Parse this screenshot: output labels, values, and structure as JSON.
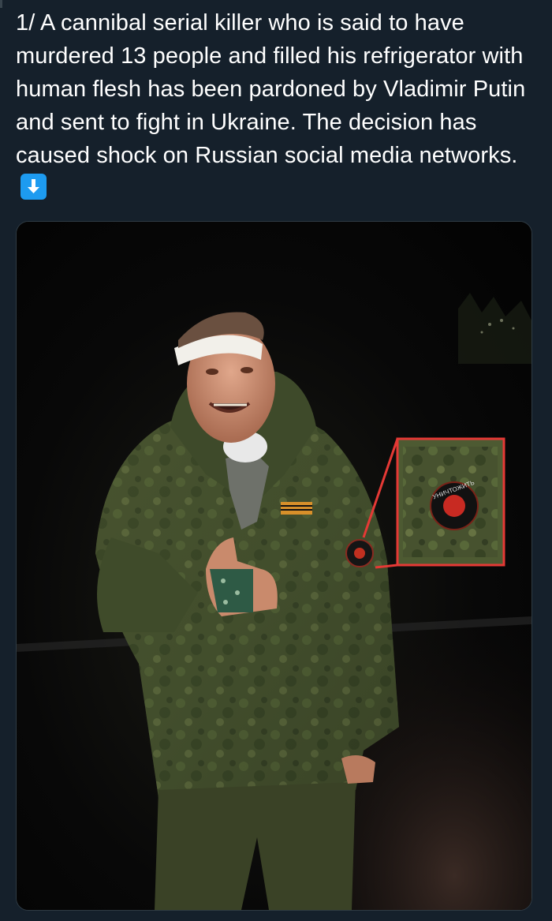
{
  "tweet": {
    "text": "1/ A cannibal serial killer who is said to have murdered 13 people and filled his refrigerator with human flesh has been pardoned by Vladimir Putin and sent to fight in Ukraine. The decision has caused shock on Russian social media networks.",
    "emoji_icon": "down-arrow-emoji-icon"
  },
  "media": {
    "icon": "photo-image",
    "highlight_color": "#e53935",
    "patch_text": "УНИЧТОЖИТЬ"
  },
  "colors": {
    "background": "#15202b",
    "text": "#ffffff",
    "emoji_blue": "#1d9bf0"
  }
}
